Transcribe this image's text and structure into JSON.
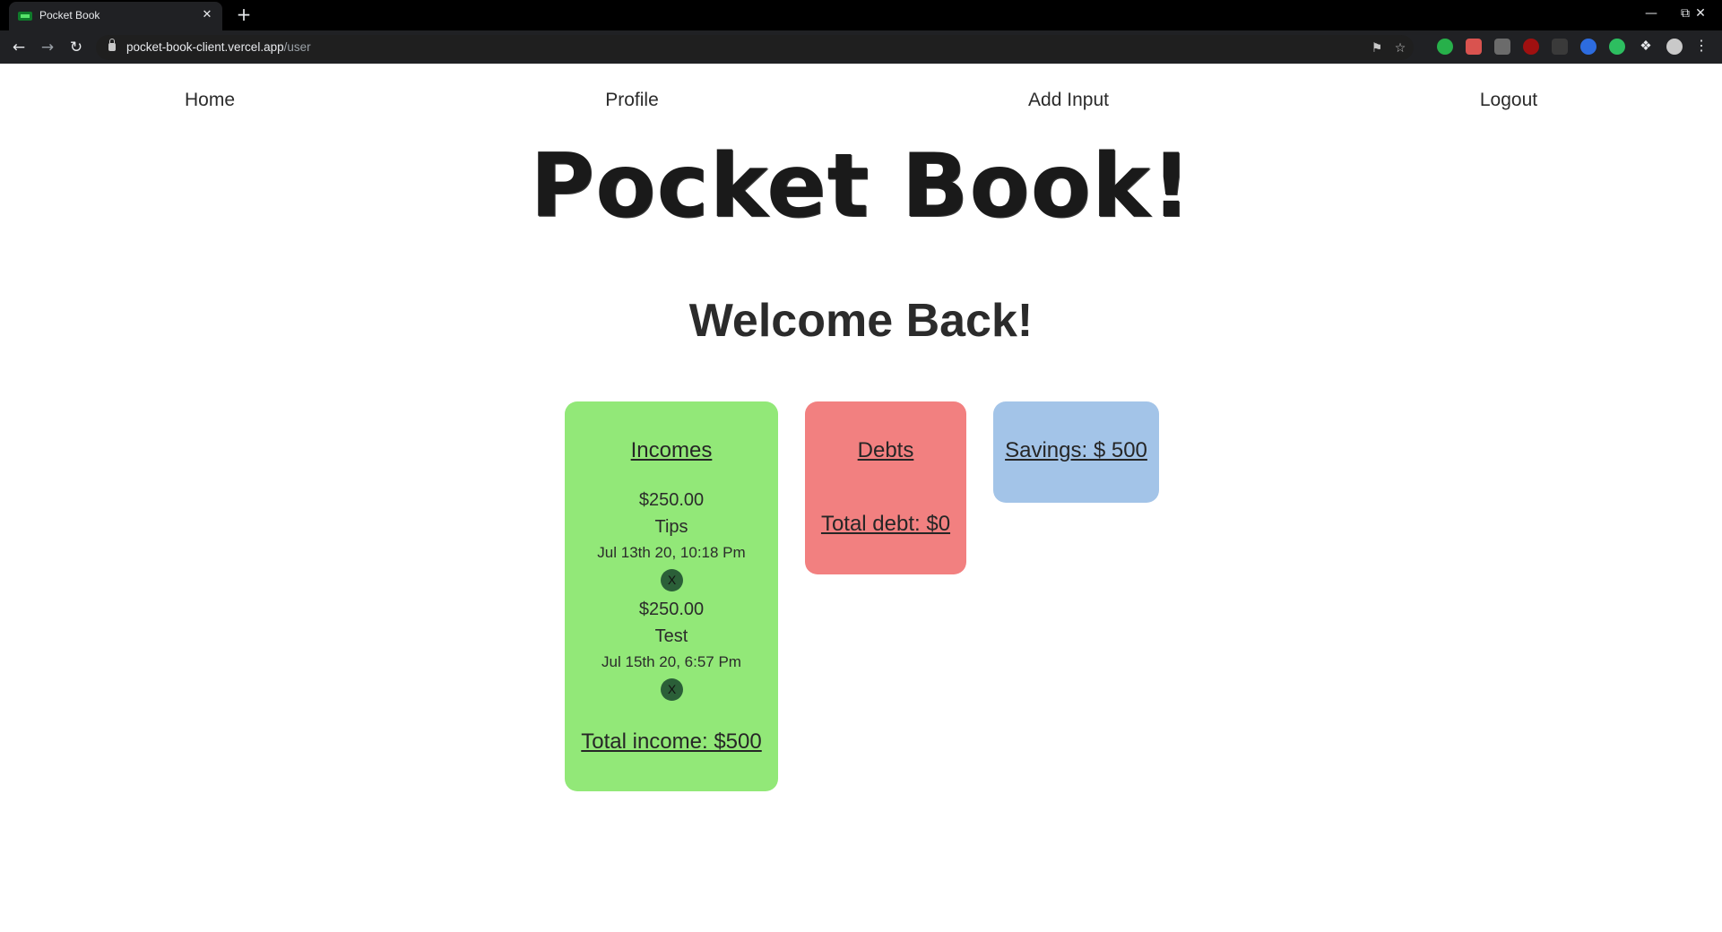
{
  "browser": {
    "tab_title": "Pocket Book",
    "url_host": "pocket-book-client.vercel.app",
    "url_path": "/user",
    "new_tab_symbol": "+",
    "close_symbol": "✕"
  },
  "nav": {
    "items": [
      {
        "label": "Home"
      },
      {
        "label": "Profile"
      },
      {
        "label": "Add Input"
      },
      {
        "label": "Logout"
      }
    ]
  },
  "brand": {
    "title": "Pocket Book!"
  },
  "welcome": {
    "text": "Welcome Back!"
  },
  "incomes": {
    "heading": "Incomes",
    "color": "#92e878",
    "entries": [
      {
        "amount": "$250.00",
        "source": "Tips",
        "date": "Jul 13th 20, 10:18 Pm",
        "delete_label": "X"
      },
      {
        "amount": "$250.00",
        "source": "Test",
        "date": "Jul 15th 20, 6:57 Pm",
        "delete_label": "X"
      }
    ],
    "total": "Total income: $500"
  },
  "debts": {
    "heading": "Debts",
    "color": "#f28080",
    "total": "Total debt: $0"
  },
  "savings": {
    "heading": "Savings: $ 500",
    "color": "#a3c4e8"
  },
  "icons": {
    "back": "back-arrow-icon",
    "forward": "forward-arrow-icon",
    "reload": "reload-icon",
    "lock": "lock-icon",
    "key": "key-icon",
    "star": "star-icon",
    "extensions": "puzzle-icon",
    "menu": "kebab-menu-icon"
  }
}
